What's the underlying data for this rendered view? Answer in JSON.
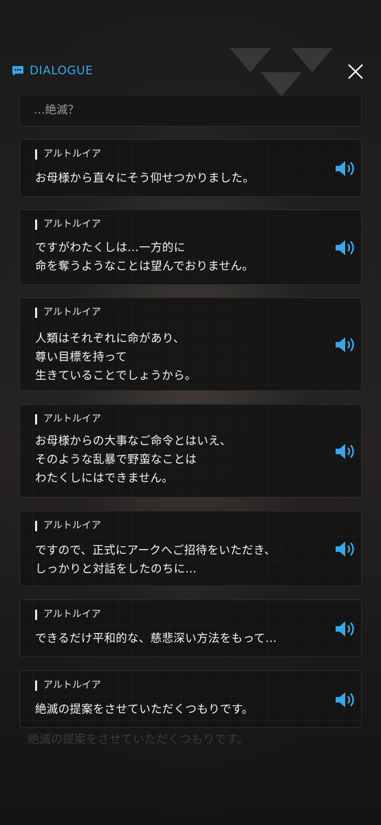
{
  "header": {
    "title": "DIALOGUE"
  },
  "partial_line": "…絶滅？",
  "ghost_line": "絶滅の提案をさせていただくつもりです。",
  "dialogues": [
    {
      "speaker": "アルトルイア",
      "lines": "お母様から直々にそう仰せつかりました。"
    },
    {
      "speaker": "アルトルイア",
      "lines": "ですがわたくしは…一方的に\n命を奪うようなことは望んでおりません。"
    },
    {
      "speaker": "アルトルイア",
      "lines": "人類はそれぞれに命があり、\n尊い目標を持って\n生きていることでしょうから。"
    },
    {
      "speaker": "アルトルイア",
      "lines": "お母様からの大事なご命令とはいえ、\nそのような乱暴で野蛮なことは\nわたくしにはできません。"
    },
    {
      "speaker": "アルトルイア",
      "lines": "ですので、正式にアークへご招待をいただき、\nしっかりと対話をしたのちに…"
    },
    {
      "speaker": "アルトルイア",
      "lines": "できるだけ平和的な、慈悲深い方法をもって…"
    },
    {
      "speaker": "アルトルイア",
      "lines": "絶滅の提案をさせていただくつもりです。"
    }
  ],
  "colors": {
    "accent": "#3aa5e8",
    "card_bg": "#141414",
    "text": "#f4f4f4"
  }
}
